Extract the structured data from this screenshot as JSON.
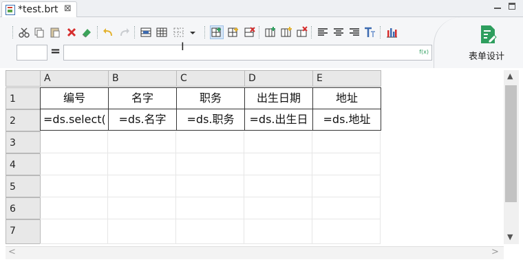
{
  "tab": {
    "title": "*test.brt",
    "close": "⊠"
  },
  "formula_bar": {
    "cell_ref": "",
    "equals": "=",
    "value": "",
    "fx_label": "f(x)",
    "caret": "I"
  },
  "design": {
    "label": "表单设计"
  },
  "toolbar_icons": [
    "cut-icon",
    "copy-icon",
    "paste-icon",
    "delete-icon",
    "clear-icon",
    "undo-icon",
    "redo-icon",
    "merge-cells-icon",
    "table-icon",
    "border-icon",
    "dropdown-icon",
    "insert-row-above-icon",
    "insert-row-below-icon",
    "delete-row-icon",
    "insert-col-left-icon",
    "insert-col-right-icon",
    "delete-col-icon",
    "align-left-icon",
    "align-center-icon",
    "align-right-icon",
    "text-format-icon",
    "chart-icon"
  ],
  "grid": {
    "columns": [
      "A",
      "B",
      "C",
      "D",
      "E"
    ],
    "rows": [
      "1",
      "2",
      "3",
      "4",
      "5",
      "6",
      "7"
    ],
    "cells": [
      [
        "编号",
        "名字",
        "职务",
        "出生日期",
        "地址"
      ],
      [
        "=ds.select(",
        "=ds.名字",
        "=ds.职务",
        "=ds.出生日",
        "=ds.地址"
      ]
    ]
  },
  "scroll": {
    "up": "▲",
    "down": "▼",
    "left": "<",
    "right": ">"
  },
  "colors": {
    "accent": "#2e9e5e",
    "header_bg": "#e8e8e8",
    "grid_line": "#333333"
  }
}
